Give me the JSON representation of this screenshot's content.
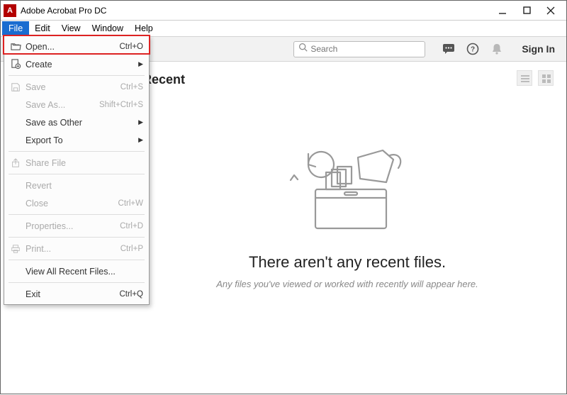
{
  "title": "Adobe Acrobat Pro DC",
  "menubar": {
    "file": "File",
    "edit": "Edit",
    "view": "View",
    "window": "Window",
    "help": "Help"
  },
  "toolbar": {
    "search_placeholder": "Search",
    "signin": "Sign In"
  },
  "recent_header": "Recent",
  "empty": {
    "title": "There aren't any recent files.",
    "subtitle": "Any files you've viewed or worked with recently will appear here."
  },
  "file_menu": {
    "open": {
      "label": "Open...",
      "shortcut": "Ctrl+O"
    },
    "create": {
      "label": "Create",
      "shortcut": ""
    },
    "save": {
      "label": "Save",
      "shortcut": "Ctrl+S"
    },
    "saveas": {
      "label": "Save As...",
      "shortcut": "Shift+Ctrl+S"
    },
    "saveother": {
      "label": "Save as Other",
      "shortcut": ""
    },
    "export": {
      "label": "Export To",
      "shortcut": ""
    },
    "share": {
      "label": "Share File",
      "shortcut": ""
    },
    "revert": {
      "label": "Revert",
      "shortcut": ""
    },
    "close": {
      "label": "Close",
      "shortcut": "Ctrl+W"
    },
    "properties": {
      "label": "Properties...",
      "shortcut": "Ctrl+D"
    },
    "print": {
      "label": "Print...",
      "shortcut": "Ctrl+P"
    },
    "viewrecent": {
      "label": "View All Recent Files...",
      "shortcut": ""
    },
    "exit": {
      "label": "Exit",
      "shortcut": "Ctrl+Q"
    }
  }
}
